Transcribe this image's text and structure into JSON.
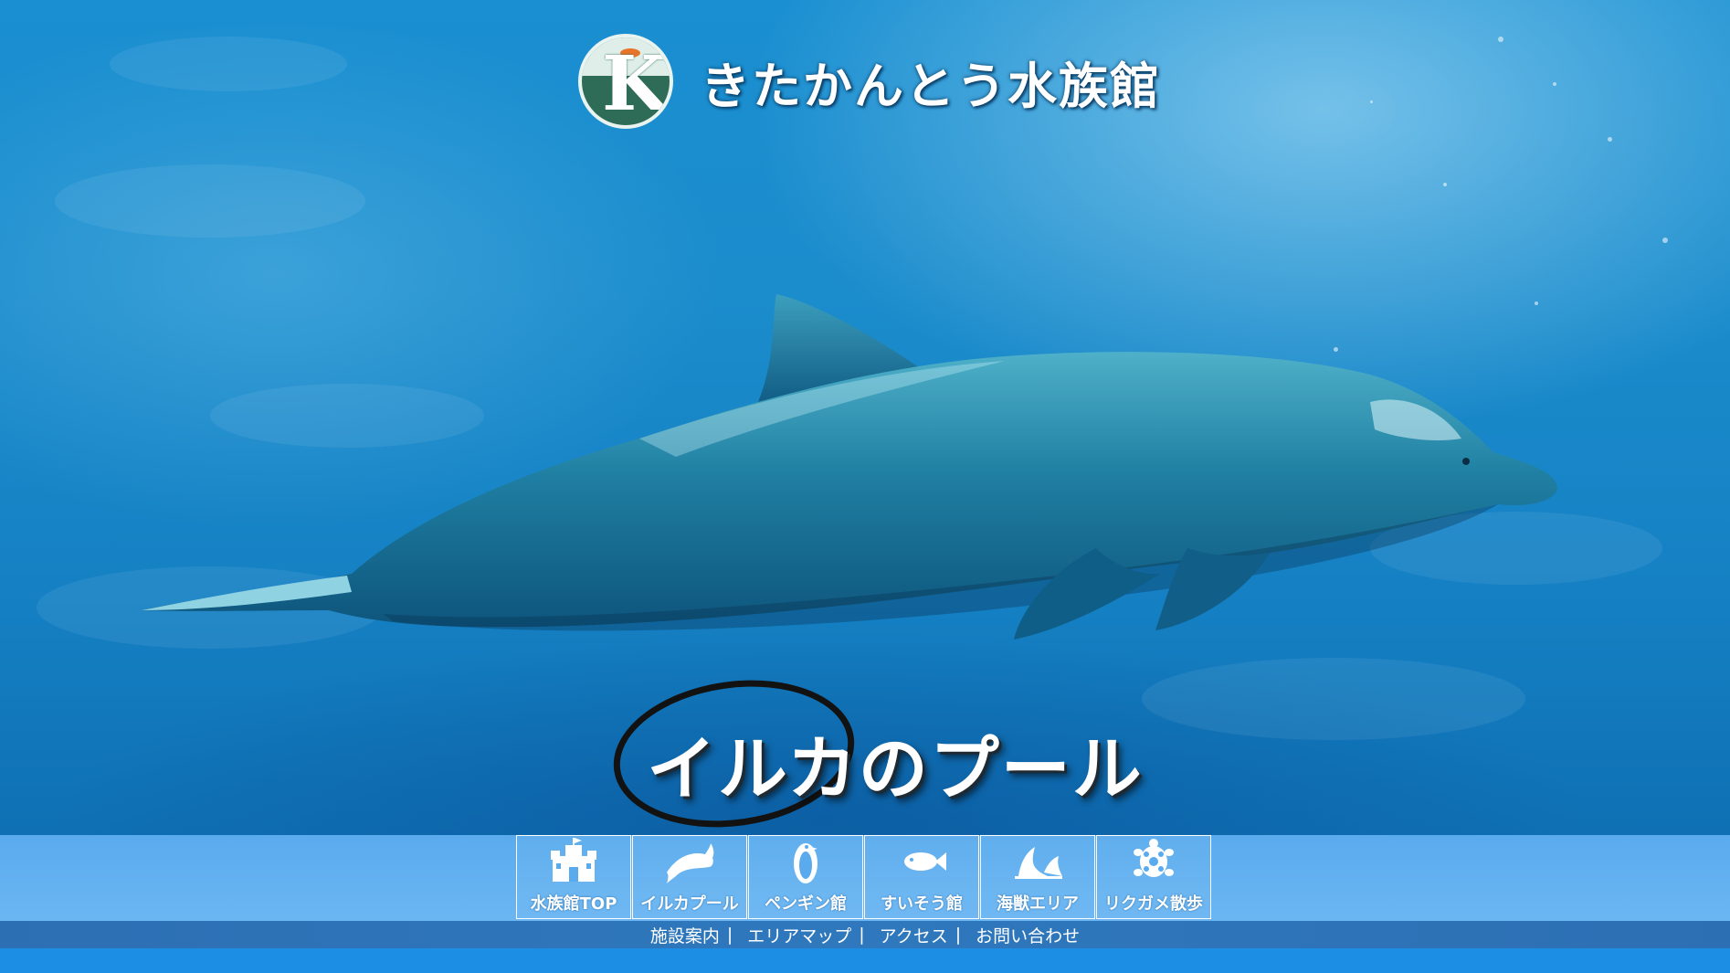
{
  "site": {
    "title": "きたかんとう水族館",
    "logo_letter": "K"
  },
  "hero": {
    "caption": "イルカのプール"
  },
  "nav": {
    "items": [
      {
        "label": "水族館TOP",
        "icon": "castle-icon"
      },
      {
        "label": "イルカプール",
        "icon": "dolphin-icon"
      },
      {
        "label": "ペンギン館",
        "icon": "penguin-icon"
      },
      {
        "label": "すいそう館",
        "icon": "fish-icon"
      },
      {
        "label": "海獣エリア",
        "icon": "seal-icon"
      },
      {
        "label": "リクガメ散歩",
        "icon": "turtle-icon"
      }
    ]
  },
  "sub_nav": {
    "links": [
      "施設案内",
      "エリアマップ",
      "アクセス",
      "お問い合わせ"
    ],
    "separator": "|"
  },
  "colors": {
    "water": "#1a8fd1",
    "nav_band": "#5aabee",
    "sub_band": "#2d6fb3",
    "bottom_band": "#1c8fe4",
    "logo_green": "#2e6c57"
  }
}
